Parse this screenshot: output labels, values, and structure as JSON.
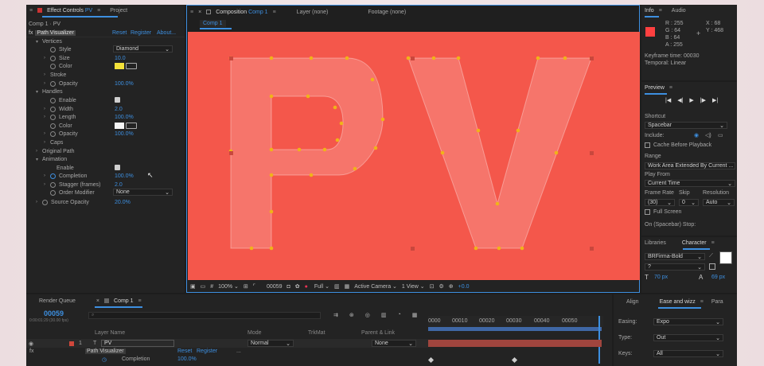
{
  "effect_panel": {
    "tab_title": "Effect Controls",
    "tab_layer": "PV",
    "project_tab": "Project",
    "breadcrumb": "Comp 1 · PV",
    "fx_name": "Path Visualizer",
    "reset": "Reset",
    "register": "Register",
    "about": "About...",
    "rows": [
      {
        "label": "Vertices",
        "value": ""
      },
      {
        "label": "Style",
        "value": "Diamond"
      },
      {
        "label": "Size",
        "value": "10.0"
      },
      {
        "label": "Color",
        "value": ""
      },
      {
        "label": "Stroke",
        "value": ""
      },
      {
        "label": "Opacity",
        "value": "100.0%"
      },
      {
        "label": "Handles",
        "value": ""
      },
      {
        "label": "Enable",
        "value": ""
      },
      {
        "label": "Width",
        "value": "2.0"
      },
      {
        "label": "Length",
        "value": "100.0%"
      },
      {
        "label": "Color",
        "value": ""
      },
      {
        "label": "Opacity",
        "value": "100.0%"
      },
      {
        "label": "Caps",
        "value": ""
      },
      {
        "label": "Original Path",
        "value": ""
      },
      {
        "label": "Animation",
        "value": ""
      },
      {
        "label": "Enable",
        "value": ""
      },
      {
        "label": "Completion",
        "value": "100.0%"
      },
      {
        "label": "Stagger (frames)",
        "value": "2.0"
      },
      {
        "label": "Order Modifier",
        "value": "None"
      },
      {
        "label": "Source Opacity",
        "value": "20.0%"
      }
    ]
  },
  "comp_panel": {
    "tab_prefix": "Composition",
    "tab_name": "Comp 1",
    "layer_tab": "Layer (none)",
    "footage_tab": "Footage (none)",
    "subtab": "Comp 1",
    "letters": "PV",
    "footer": {
      "zoom": "100%",
      "timecode": "00059",
      "quality": "Full",
      "camera": "Active Camera",
      "view": "1 View",
      "offset": "+0.0"
    }
  },
  "info_panel": {
    "tab_info": "Info",
    "tab_audio": "Audio",
    "r": "R : 255",
    "g": "G : 64",
    "b": "B : 64",
    "a": "A : 255",
    "x": "X : 68",
    "y": "Y : 468",
    "kf_time": "Keyframe time: 00030",
    "kf_interp": "Temporal: Linear"
  },
  "preview_panel": {
    "title": "Preview",
    "shortcut_label": "Shortcut",
    "shortcut_value": "Spacebar",
    "include_label": "Include:",
    "cache_label": "Cache Before Playback",
    "range_label": "Range",
    "range_value": "Work Area Extended By Current ...",
    "play_from_label": "Play From",
    "play_from_value": "Current Time",
    "fr_label": "Frame Rate",
    "skip_label": "Skip",
    "res_label": "Resolution",
    "fr_value": "(30)",
    "skip_value": "0",
    "res_value": "Auto",
    "fullscreen_label": "Full Screen",
    "on_stop_label": "On (Spacebar) Stop:"
  },
  "char_panel": {
    "tab_libraries": "Libraries",
    "tab_character": "Character",
    "font": "BRFirma-Bold",
    "style": "?",
    "size": "70 px",
    "leading": "69 px"
  },
  "timeline": {
    "tab_render": "Render Queue",
    "tab_comp": "Comp 1",
    "timecode": "00059",
    "sub_time": "0:00:01:29 (30.00 fps)",
    "col_layer": "Layer Name",
    "col_mode": "Mode",
    "col_trkmat": "TrkMat",
    "col_parent": "Parent & Link",
    "layer_num": "1",
    "layer_name": "PV",
    "layer_mode": "Normal",
    "layer_parent": "None",
    "fx_row": "Path Visualizer",
    "fx_reset": "Reset",
    "fx_register": "Register",
    "fx_more": "...",
    "completion_label": "Completion",
    "completion_value": "100.0%",
    "ruler": [
      "0000",
      "00010",
      "00020",
      "00030",
      "00040",
      "00050"
    ]
  },
  "ease_panel": {
    "tab_align": "Align",
    "tab_ease": "Ease and wizz",
    "tab_para": "Para",
    "easing_label": "Easing:",
    "easing_value": "Expo",
    "type_label": "Type:",
    "type_value": "Out",
    "keys_label": "Keys:",
    "keys_value": "All"
  },
  "colors": {
    "canvas": "#f4574b",
    "accent": "#3d8fe0",
    "vertex": "#f0b319"
  }
}
